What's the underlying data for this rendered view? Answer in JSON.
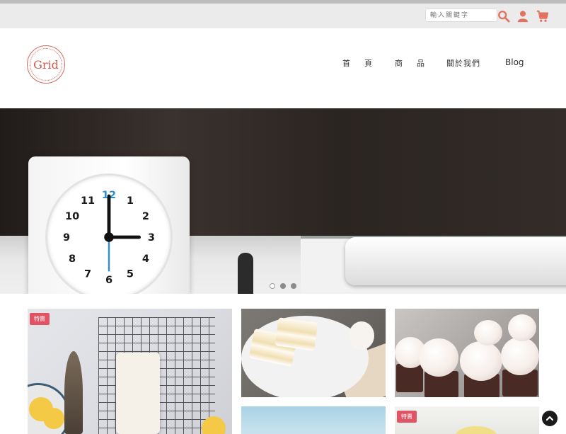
{
  "topbar": {
    "search_placeholder": "輸入關鍵字",
    "icons": [
      "search-icon",
      "user-icon",
      "cart-icon"
    ],
    "accent_color": "#e0725f"
  },
  "header": {
    "logo_text": "Grid",
    "logo_color": "#d0584c",
    "nav": [
      {
        "label": "首頁"
      },
      {
        "label": "商品"
      },
      {
        "label": "關於我們"
      },
      {
        "label": "Blog"
      }
    ]
  },
  "hero": {
    "clock_numbers": [
      "12",
      "1",
      "2",
      "3",
      "4",
      "5",
      "6",
      "7",
      "8",
      "9",
      "10",
      "11"
    ],
    "clock_time": "3:00",
    "slide_count": 3,
    "active_slide": 0
  },
  "products": {
    "badge_label": "特賣",
    "badge_color": "#e05566",
    "items": [
      {
        "name": "lemon-loaf-cake",
        "badge": true
      },
      {
        "name": "mille-feuille-slices",
        "badge": false
      },
      {
        "name": "cupcakes",
        "badge": false
      },
      {
        "name": "sky-photo",
        "badge": false
      },
      {
        "name": "lemon-dessert",
        "badge": true
      }
    ]
  },
  "back_to_top_icon": "chevron-up-icon"
}
